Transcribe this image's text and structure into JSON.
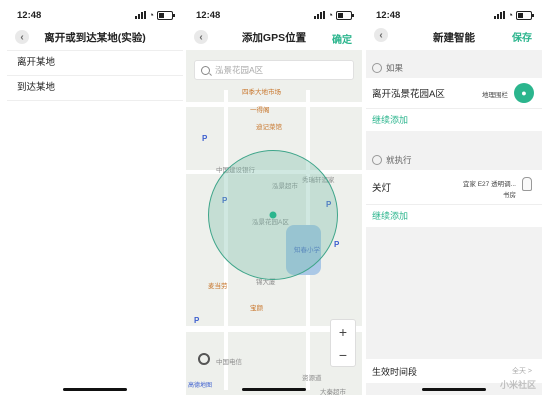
{
  "status_time": "12:48",
  "screen1": {
    "title": "离开或到达某地(实验)",
    "options": [
      "离开某地",
      "到达某地"
    ]
  },
  "screen2": {
    "title": "添加GPS位置",
    "confirm": "确定",
    "search_placeholder": "泓景花园A区",
    "zoom_in": "+",
    "zoom_out": "−",
    "map_labels": [
      "四季大地市场",
      "一得阁",
      "迪记菜馆",
      "中国建设银行",
      "泓景超市",
      "秀瑞轩酒家",
      "泓景花园A区",
      "知春小学",
      "锦大厦",
      "宝颜",
      "中国电信",
      "资源道",
      "大秦超市",
      "麦当劳"
    ],
    "logo": "高德地图"
  },
  "screen3": {
    "title": "新建智能",
    "save": "保存",
    "if_label": "如果",
    "if_item": "离开泓景花园A区",
    "if_item_tag": "地理围栏",
    "if_add": "继续添加",
    "then_label": "就执行",
    "then_item": "关灯",
    "then_device": "宜家 E27 透明调...",
    "then_room": "书房",
    "then_add": "继续添加",
    "period_label": "生效时间段",
    "period_value": "全天 >"
  },
  "watermark": "小米社区"
}
